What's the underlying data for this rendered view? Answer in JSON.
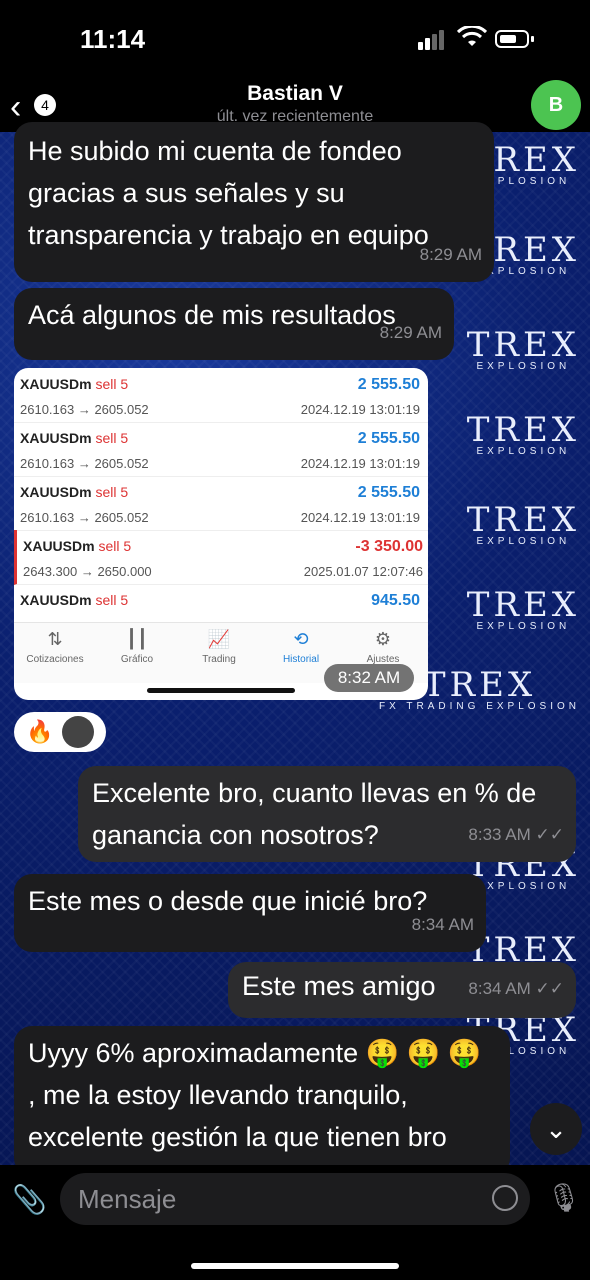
{
  "status": {
    "time": "11:14"
  },
  "header": {
    "back_count": "4",
    "title": "Bastian V",
    "subtitle": "últ. vez recientemente",
    "avatar_initial": "B"
  },
  "wallpaper": {
    "logo_big": "TREX",
    "logo_small": "EXPLOSION",
    "logo_small2": "FX TRADING EXPLOSION"
  },
  "messages": [
    {
      "text": "He subido mi cuenta de fondeo gracias a sus señales y su transparencia y trabajo en equipo",
      "time": "8:29 AM"
    },
    {
      "text": "Acá algunos de mis resultados",
      "time": "8:29 AM"
    },
    {
      "text": "Excelente bro, cuanto llevas en % de ganancia con nosotros?",
      "time": "8:33 AM"
    },
    {
      "text": "Este mes o desde que inicié bro?",
      "time": "8:34 AM"
    },
    {
      "text": "Este mes amigo",
      "time": "8:34 AM"
    },
    {
      "text": "Uyyy 6% aproximadamente 🤑 🤑 🤑 , me la estoy llevando tranquilo, excelente gestión la que tienen bro",
      "time": ""
    }
  ],
  "image_message": {
    "time": "8:32 AM",
    "trades": [
      {
        "symbol": "XAUUSDm",
        "type": "sell 5",
        "prices": "2610.163 → 2605.052",
        "profit": "2 555.50",
        "date": "2024.12.19 13:01:19"
      },
      {
        "symbol": "XAUUSDm",
        "type": "sell 5",
        "prices": "2610.163 → 2605.052",
        "profit": "2 555.50",
        "date": "2024.12.19 13:01:19"
      },
      {
        "symbol": "XAUUSDm",
        "type": "sell 5",
        "prices": "2610.163 → 2605.052",
        "profit": "2 555.50",
        "date": "2024.12.19 13:01:19"
      },
      {
        "symbol": "XAUUSDm",
        "type": "sell 5",
        "prices": "2643.300 → 2650.000",
        "profit": "-3 350.00",
        "date": "2025.01.07 12:07:46"
      },
      {
        "symbol": "XAUUSDm",
        "type": "sell 5",
        "prices": "",
        "profit": "945.50",
        "date": ""
      }
    ],
    "tabs": [
      "Cotizaciones",
      "Gráfico",
      "Trading",
      "Historial",
      "Ajustes"
    ],
    "profit_color": "#1e7fd6",
    "loss_color": "#d33"
  },
  "reactions": {
    "emoji": "🔥"
  },
  "input": {
    "placeholder": "Mensaje"
  }
}
